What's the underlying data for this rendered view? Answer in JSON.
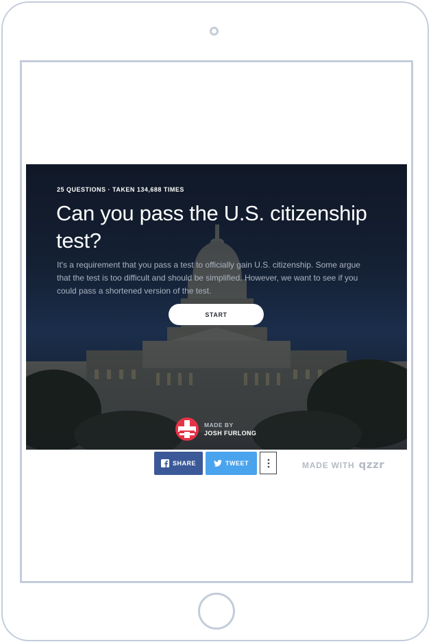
{
  "quiz": {
    "meta": "25 QUESTIONS · TAKEN 134,688 TIMES",
    "title": "Can you pass the U.S. citizenship test?",
    "description": "It's a requirement that you pass a test to officially gain U.S. citizenship. Some argue that the test is too difficult and should be simplified. However, we want to see if you could pass a shortened version of the test.",
    "start_label": "START",
    "background_image": "us-capitol-at-night"
  },
  "author": {
    "made_by_label": "MADE BY",
    "name": "JOSH FURLONG",
    "avatar_icon": "red-white-cross-badge-icon"
  },
  "share": {
    "facebook_label": "SHARE",
    "twitter_label": "TWEET",
    "more_icon": "vertical-ellipsis-icon"
  },
  "footer": {
    "made_with_label": "MADE WITH",
    "brand": "qzzr"
  },
  "colors": {
    "facebook": "#3b5998",
    "twitter": "#4aa3ed",
    "tablet_frame": "#c3ccd9",
    "avatar_red": "#e53347"
  }
}
